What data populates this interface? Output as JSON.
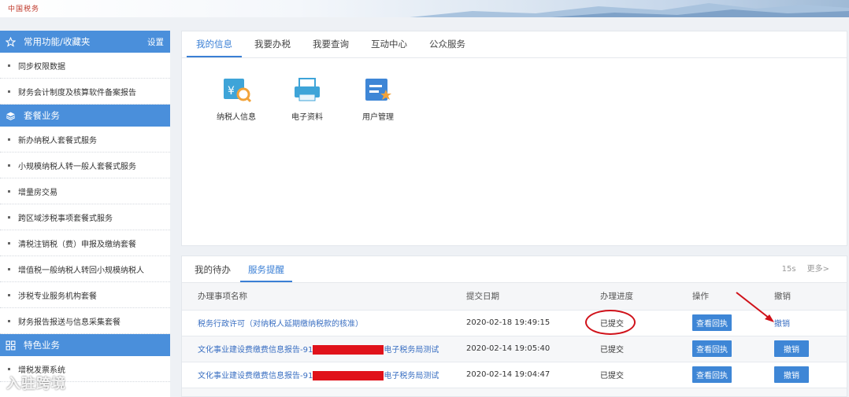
{
  "banner": {
    "logo_text": "中国税务"
  },
  "sidebar": {
    "favorites": {
      "title": "常用功能/收藏夹",
      "setting": "设置",
      "items": [
        "同步权限数据",
        "财务会计制度及核算软件备案报告"
      ]
    },
    "package": {
      "title": "套餐业务",
      "items": [
        "新办纳税人套餐式服务",
        "小规模纳税人转一般人套餐式服务",
        "增量房交易",
        "跨区域涉税事项套餐式服务",
        "清税注销税（费）申报及缴纳套餐",
        "增值税一般纳税人转回小规模纳税人",
        "涉税专业服务机构套餐",
        "财务报告报送与信息采集套餐"
      ]
    },
    "special": {
      "title": "特色业务",
      "items": [
        "增税发票系统"
      ]
    }
  },
  "top_tabs": [
    "我的信息",
    "我要办税",
    "我要查询",
    "互动中心",
    "公众服务"
  ],
  "apps": [
    {
      "label": "纳税人信息",
      "icon": "taxpayer-info-icon"
    },
    {
      "label": "电子资料",
      "icon": "printer-icon"
    },
    {
      "label": "用户管理",
      "icon": "user-manage-icon"
    }
  ],
  "bottom_tabs": [
    "我的待办",
    "服务提醒"
  ],
  "bottom_right": {
    "interval": "15s",
    "more": "更多>"
  },
  "table": {
    "headers": [
      "办理事项名称",
      "提交日期",
      "办理进度",
      "操作",
      "撤销"
    ],
    "rows": [
      {
        "name": "税务行政许可（对纳税人延期缴纳税款的核准）",
        "name_suffix": "",
        "date": "2020-02-18 19:49:15",
        "status": "已提交",
        "action": "查看回执",
        "undo": "撤销"
      },
      {
        "name": "文化事业建设费缴费信息报告-91",
        "name_suffix": "电子税务局测试",
        "date": "2020-02-14 19:05:40",
        "status": "已提交",
        "action": "查看回执",
        "undo": "撤销"
      },
      {
        "name": "文化事业建设费缴费信息报告-91",
        "name_suffix": "电子税务局测试",
        "date": "2020-02-14 19:04:47",
        "status": "已提交",
        "action": "查看回执",
        "undo": "撤销"
      }
    ]
  },
  "watermark": "入驻跨境",
  "colors": {
    "accent": "#4a8fdb",
    "annotation": "#d0121a"
  }
}
